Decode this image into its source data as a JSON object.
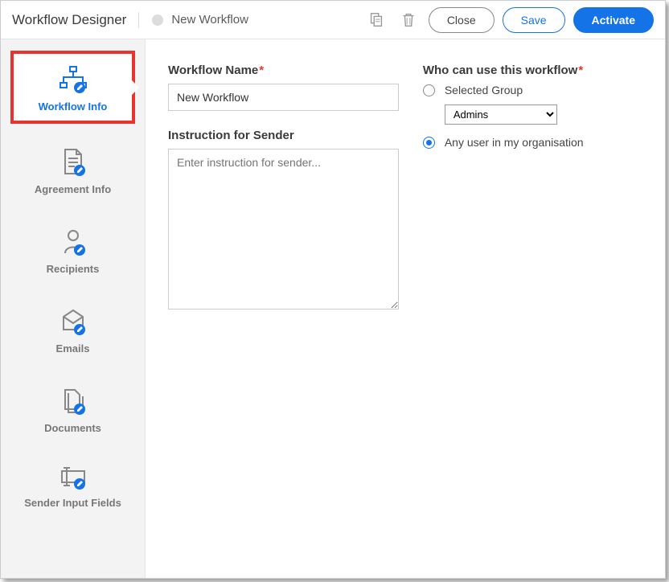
{
  "header": {
    "app_title": "Workflow Designer",
    "workflow_name": "New Workflow",
    "buttons": {
      "close": "Close",
      "save": "Save",
      "activate": "Activate"
    }
  },
  "sidebar": {
    "items": [
      {
        "label": "Workflow Info"
      },
      {
        "label": "Agreement Info"
      },
      {
        "label": "Recipients"
      },
      {
        "label": "Emails"
      },
      {
        "label": "Documents"
      },
      {
        "label": "Sender Input Fields"
      }
    ]
  },
  "form": {
    "workflow_name_label": "Workflow Name",
    "workflow_name_value": "New Workflow",
    "instruction_label": "Instruction for Sender",
    "instruction_placeholder": "Enter instruction for sender...",
    "who_label": "Who can use this workflow",
    "radio_selected_group": "Selected Group",
    "radio_any_user": "Any user in my organisation",
    "group_options": [
      "Admins"
    ],
    "group_selected": "Admins"
  }
}
